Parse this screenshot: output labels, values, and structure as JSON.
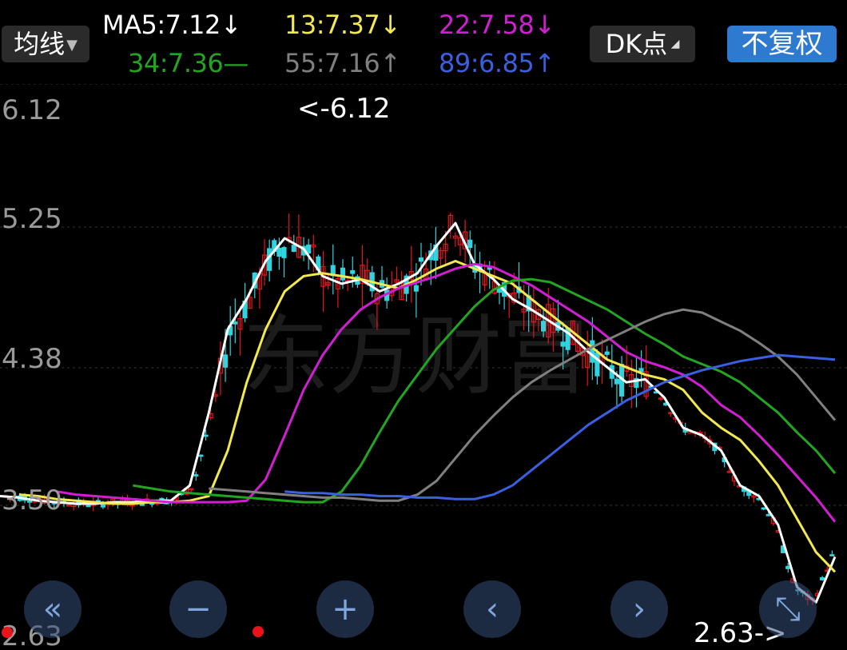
{
  "header": {
    "ma_type_label": "均线",
    "dk_label": "DK点",
    "fq_label": "不复权",
    "ma_items": [
      {
        "label": "MA5:7.12↓",
        "color": "#ffffff"
      },
      {
        "label": "13:7.37↓",
        "color": "#f2e94e"
      },
      {
        "label": "22:7.58↓",
        "color": "#d21ed2"
      },
      {
        "label": "34:7.36—",
        "color": "#22a622"
      },
      {
        "label": "55:7.16↑",
        "color": "#808080"
      },
      {
        "label": "89:6.85↑",
        "color": "#3a5fe0"
      }
    ]
  },
  "chart": {
    "y_ticks": [
      "6.12",
      "5.25",
      "4.38",
      "3.50",
      "2.63"
    ],
    "max_label": "<-6.12",
    "min_label": "2.63->",
    "watermark": "东方财富",
    "colors": {
      "up": "#e8141c",
      "down": "#2fd4e0",
      "bg": "#000000"
    }
  },
  "chart_data": {
    "type": "candlestick",
    "ylim": [
      2.63,
      6.12
    ],
    "y_ticks": [
      6.12,
      5.25,
      4.38,
      3.5,
      2.63
    ],
    "max_marker": 6.12,
    "min_marker": 2.63,
    "series": [
      {
        "name": "MA5",
        "color": "#ffffff",
        "y": [
          3.55,
          3.54,
          3.52,
          3.51,
          3.5,
          3.5,
          3.51,
          3.51,
          3.52,
          3.52,
          3.62,
          4.1,
          4.65,
          4.85,
          5.1,
          5.25,
          5.18,
          5.0,
          4.95,
          4.98,
          4.9,
          4.95,
          5.02,
          5.2,
          5.35,
          5.08,
          4.98,
          4.85,
          4.78,
          4.7,
          4.62,
          4.5,
          4.4,
          4.3,
          4.32,
          4.2,
          4.0,
          3.95,
          3.85,
          3.62,
          3.55,
          3.36,
          2.95,
          2.85,
          3.15
        ]
      },
      {
        "name": "13",
        "color": "#f2e94e",
        "y": [
          3.56,
          3.55,
          3.53,
          3.52,
          3.51,
          3.5,
          3.5,
          3.51,
          3.51,
          3.52,
          3.55,
          3.85,
          4.3,
          4.65,
          4.9,
          5.0,
          5.02,
          5.0,
          4.98,
          4.95,
          4.92,
          4.98,
          5.05,
          5.1,
          5.05,
          5.0,
          4.95,
          4.85,
          4.75,
          4.65,
          4.55,
          4.45,
          4.4,
          4.35,
          4.32,
          4.25,
          4.1,
          4.0,
          3.92,
          3.78,
          3.62,
          3.4,
          3.18,
          3.05
        ]
      },
      {
        "name": "22",
        "color": "#d21ed2",
        "y": [
          3.58,
          3.56,
          3.55,
          3.54,
          3.53,
          3.52,
          3.51,
          3.51,
          3.51,
          3.51,
          3.52,
          3.66,
          3.95,
          4.25,
          4.48,
          4.65,
          4.78,
          4.86,
          4.92,
          4.96,
          5.0,
          5.05,
          5.08,
          5.06,
          5.0,
          4.94,
          4.86,
          4.78,
          4.7,
          4.6,
          4.5,
          4.44,
          4.4,
          4.35,
          4.27,
          4.15,
          4.07,
          3.95,
          3.82,
          3.68,
          3.54,
          3.38
        ]
      },
      {
        "name": "34",
        "color": "#22a622",
        "y": [
          3.62,
          3.6,
          3.58,
          3.57,
          3.56,
          3.55,
          3.54,
          3.53,
          3.52,
          3.51,
          3.51,
          3.58,
          3.75,
          3.97,
          4.18,
          4.35,
          4.52,
          4.66,
          4.8,
          4.91,
          4.97,
          4.98,
          4.96,
          4.9,
          4.84,
          4.78,
          4.7,
          4.62,
          4.55,
          4.47,
          4.42,
          4.37,
          4.3,
          4.2,
          4.1,
          3.97,
          3.85,
          3.7
        ]
      },
      {
        "name": "55",
        "color": "#808080",
        "y": [
          3.6,
          3.59,
          3.58,
          3.57,
          3.56,
          3.55,
          3.54,
          3.54,
          3.53,
          3.52,
          3.52,
          3.56,
          3.65,
          3.8,
          3.95,
          4.08,
          4.2,
          4.3,
          4.38,
          4.45,
          4.52,
          4.58,
          4.64,
          4.7,
          4.75,
          4.78,
          4.76,
          4.7,
          4.64,
          4.56,
          4.47,
          4.35,
          4.2,
          4.05
        ]
      },
      {
        "name": "89",
        "color": "#3a5fe0",
        "y": [
          3.58,
          3.57,
          3.57,
          3.56,
          3.56,
          3.55,
          3.55,
          3.54,
          3.54,
          3.53,
          3.53,
          3.56,
          3.62,
          3.72,
          3.82,
          3.92,
          4.02,
          4.1,
          4.18,
          4.24,
          4.3,
          4.34,
          4.38,
          4.41,
          4.44,
          4.46,
          4.48,
          4.47,
          4.46,
          4.45
        ]
      }
    ]
  },
  "nav": {
    "first_icon": "«",
    "minus_icon": "−",
    "plus_icon": "+",
    "prev_icon": "‹",
    "next_icon": "›",
    "expand_icon": "⤡"
  }
}
